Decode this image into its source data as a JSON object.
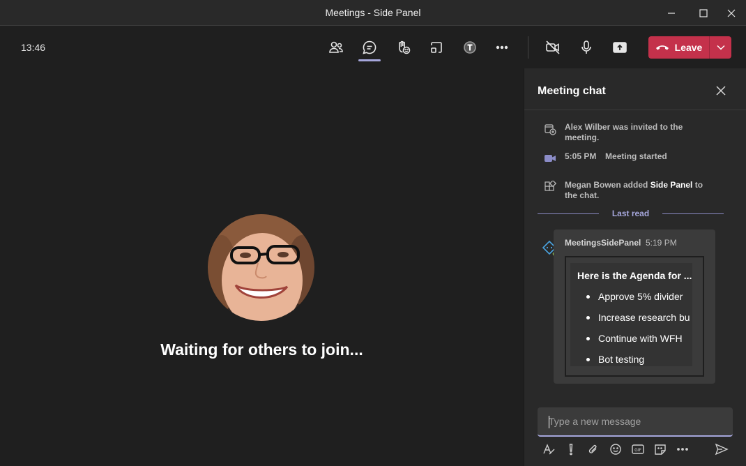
{
  "window": {
    "title": "Meetings - Side Panel"
  },
  "toolbar": {
    "clock": "13:46",
    "leave_label": "Leave"
  },
  "stage": {
    "waiting_text": "Waiting for others to join..."
  },
  "panel": {
    "title": "Meeting chat",
    "events": [
      {
        "icon": "calendar-add-icon",
        "text": "Alex Wilber was invited to the meeting."
      },
      {
        "icon": "video-camera-icon",
        "time": "5:05 PM",
        "text": "Meeting started"
      },
      {
        "icon": "apps-add-icon",
        "prefix": "Megan Bowen added ",
        "bold": "Side Panel",
        "suffix": " to the chat."
      }
    ],
    "last_read": "Last read",
    "message": {
      "sender": "MeetingsSidePanel",
      "time": "5:19 PM",
      "card": {
        "title": "Here is the Agenda for ...",
        "items": [
          "Approve 5% divider",
          "Increase research bu",
          "Continue with WFH",
          "Bot testing"
        ]
      }
    },
    "compose": {
      "placeholder": "Type a new message"
    }
  },
  "colors": {
    "accent": "#a6a7dc",
    "leave": "#c4314b",
    "panel_bg": "#292929",
    "stage_bg": "#1f1f1f"
  }
}
